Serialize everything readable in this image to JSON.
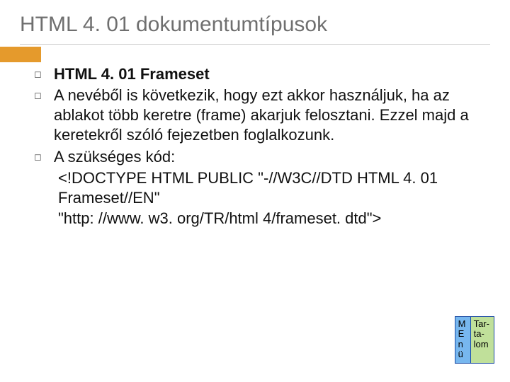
{
  "title": "HTML 4. 01 dokumentumtípusok",
  "bullets": {
    "b1": "HTML 4. 01 Frameset",
    "b2": "A nevéből is következik, hogy ezt akkor használjuk, ha az ablakot több keretre (frame) akarjuk felosztani. Ezzel majd a keretekről szóló fejezetben foglalkozunk.",
    "b3": "A szükséges kód:",
    "code1": "<!DOCTYPE HTML PUBLIC \"-//W3C//DTD HTML 4. 01 Frameset//EN\"",
    "code2": " \"http: //www. w3. org/TR/html 4/frameset. dtd\">"
  },
  "nav": {
    "menu": "M\nE\nn\nü",
    "toc": "Tar-\nta-\nlom"
  }
}
